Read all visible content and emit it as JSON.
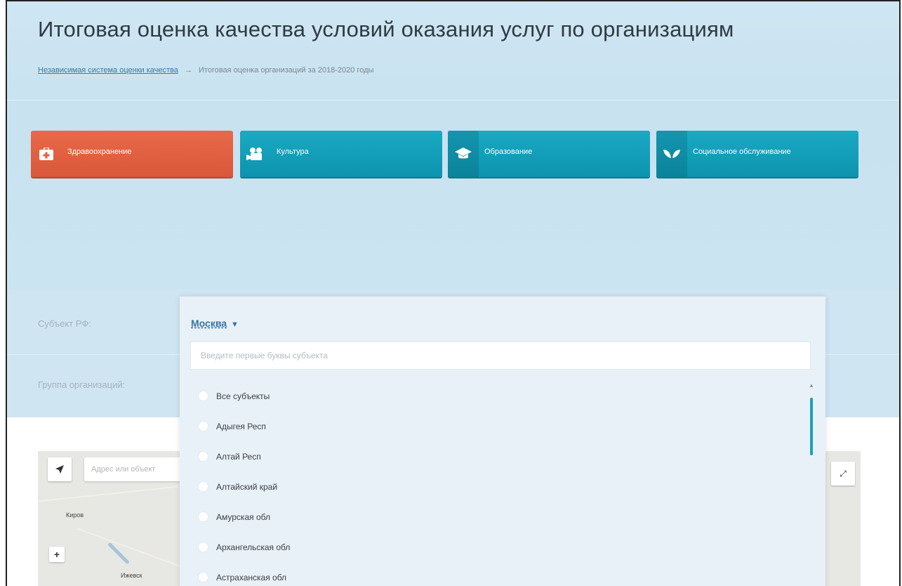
{
  "page": {
    "title": "Итоговая оценка качества условий оказания услуг по организациям"
  },
  "breadcrumb": {
    "root": "Независимая система оценки качества",
    "separator": "→",
    "current": "Итоговая оценка организаций за 2018-2020 годы"
  },
  "categories": [
    {
      "label": "Здравоохранение",
      "icon": "medical-kit-icon",
      "active": true
    },
    {
      "label": "Культура",
      "icon": "film-camera-icon",
      "active": false
    },
    {
      "label": "Образование",
      "icon": "graduation-cap-icon",
      "active": false
    },
    {
      "label": "Социальное обслуживание",
      "icon": "hands-icon",
      "active": false
    }
  ],
  "filters": {
    "subject_label": "Субъект РФ:",
    "group_label": "Группа организаций:"
  },
  "subject_dropdown": {
    "selected": "Москва",
    "arrow": "▼",
    "search_placeholder": "Введите первые буквы субъекта",
    "options": [
      "Все субъекты",
      "Адыгея Респ",
      "Алтай Респ",
      "Алтайский край",
      "Амурская обл",
      "Архангельская обл",
      "Астраханская обл"
    ]
  },
  "map": {
    "search_placeholder": "Адрес или объект",
    "zoom_in": "+",
    "cities": [
      "Киров",
      "Ижевск"
    ]
  },
  "colors": {
    "header_bg": "#cfe5f1",
    "active_category": "#e0603f",
    "category": "#14a0ba",
    "link": "#3674a3",
    "scrollbar": "#1ea0b9"
  }
}
